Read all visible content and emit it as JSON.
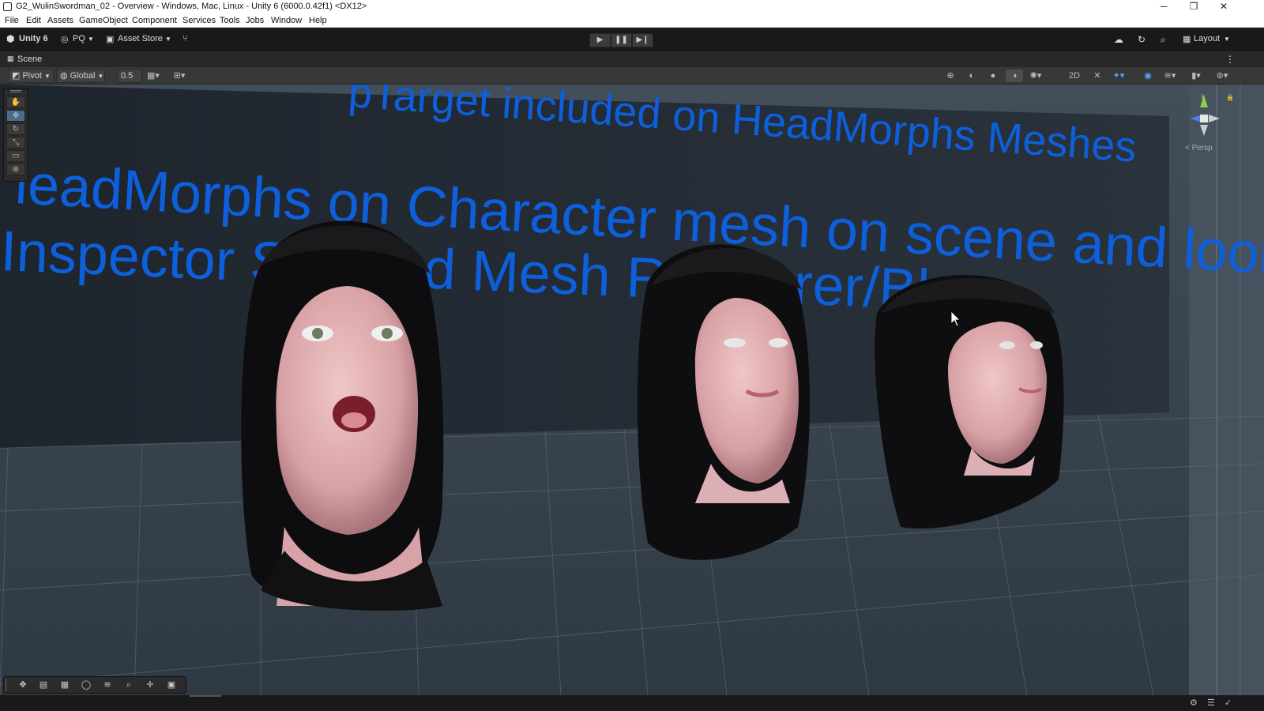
{
  "window": {
    "title": "G2_WulinSwordman_02 - Overview - Windows, Mac, Linux - Unity 6 (6000.0.42f1) <DX12>",
    "minimize_glyph": "─",
    "maximize_glyph": "❐",
    "close_glyph": "✕"
  },
  "menu": {
    "items": [
      "File",
      "Edit",
      "Assets",
      "GameObject",
      "Component",
      "Services",
      "Tools",
      "Jobs",
      "Window",
      "Help"
    ]
  },
  "toolbar": {
    "unity_label": "Unity 6",
    "account_label": "PQ",
    "asset_store_label": "Asset Store",
    "layout_label": "Layout"
  },
  "scene_tab": {
    "label": "Scene"
  },
  "scene_toolbar": {
    "pivot_label": "Pivot",
    "global_label": "Global",
    "snap_value": "0.5"
  },
  "viewport": {
    "persp_label": "< Persp",
    "gizmo_axes": {
      "y": "y",
      "z": "z"
    },
    "text_lines": [
      "pTarget included on HeadMorphs Meshes",
      "leadMorphs on Character mesh on scene and look at",
      "Inspector Skinned Mesh Renderer/Ble"
    ],
    "colors": {
      "wall": "#232a33",
      "floor": "#3b4651",
      "text": "#0d5fdc",
      "accent": "#4a9cff"
    }
  },
  "icons": {
    "tool_palette": [
      "hand-icon",
      "move-icon",
      "rotate-icon",
      "scale-icon",
      "rect-icon",
      "transform-icon"
    ],
    "overlay_bar": [
      "move-tool-icon",
      "grid-icon",
      "snap-icon",
      "orbit-icon",
      "layers-icon",
      "search-icon",
      "center-icon",
      "camera-icon"
    ]
  }
}
